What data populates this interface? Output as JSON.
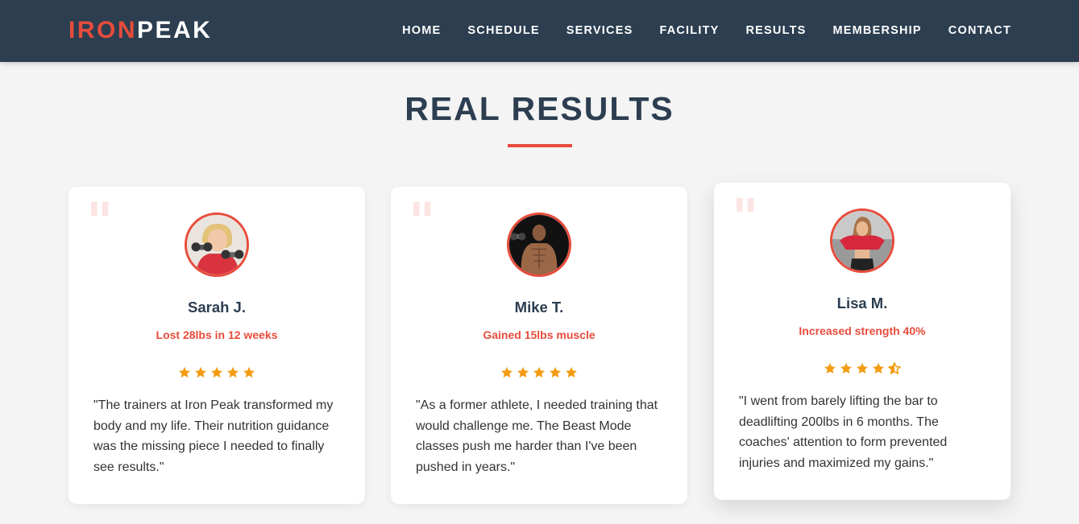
{
  "brand": {
    "part1": "IRON",
    "part2": "PEAK"
  },
  "nav": {
    "items": [
      "HOME",
      "SCHEDULE",
      "SERVICES",
      "FACILITY",
      "RESULTS",
      "MEMBERSHIP",
      "CONTACT"
    ]
  },
  "section": {
    "title": "REAL RESULTS"
  },
  "testimonials": [
    {
      "name": "Sarah J.",
      "result": "Lost 28lbs in 12 weeks",
      "rating": 5,
      "quote": "\"The trainers at Iron Peak transformed my body and my life. Their nutrition guidance was the missing piece I needed to finally see results.\""
    },
    {
      "name": "Mike T.",
      "result": "Gained 15lbs muscle",
      "rating": 5,
      "quote": "\"As a former athlete, I needed training that would challenge me. The Beast Mode classes push me harder than I've been pushed in years.\""
    },
    {
      "name": "Lisa M.",
      "result": "Increased strength 40%",
      "rating": 4.5,
      "quote": "\"I went from barely lifting the bar to deadlifting 200lbs in 6 months. The coaches' attention to form prevented injuries and maximized my gains.\""
    }
  ],
  "colors": {
    "navbar": "#2c3e50",
    "accent": "#e74c3c",
    "star": "#f39c12",
    "background": "#f4f4f4"
  }
}
